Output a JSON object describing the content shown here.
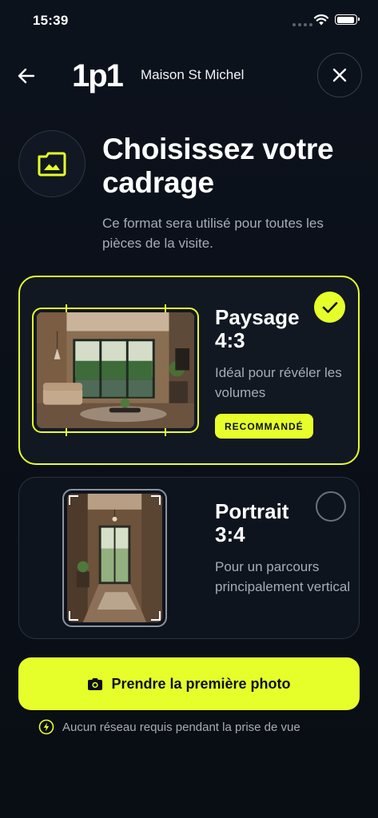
{
  "status_bar": {
    "time": "15:39"
  },
  "header": {
    "logo": "1p1",
    "property_name": "Maison St Michel"
  },
  "intro": {
    "title": "Choisissez votre cadrage",
    "subtitle": "Ce format sera utilisé pour toutes les pièces de la visite."
  },
  "options": [
    {
      "title": "Paysage 4:3",
      "description": "Idéal pour révéler les volumes",
      "badge": "RECOMMANDÉ",
      "selected": true
    },
    {
      "title": "Portrait 3:4",
      "description": "Pour un parcours principalement vertical",
      "selected": false
    }
  ],
  "cta": {
    "label": "Prendre la première photo"
  },
  "footnote": {
    "text": "Aucun réseau requis pendant la prise de vue"
  },
  "colors": {
    "accent": "#e6ff2a",
    "background": "#0b1018",
    "muted_text": "#a6acb6"
  }
}
